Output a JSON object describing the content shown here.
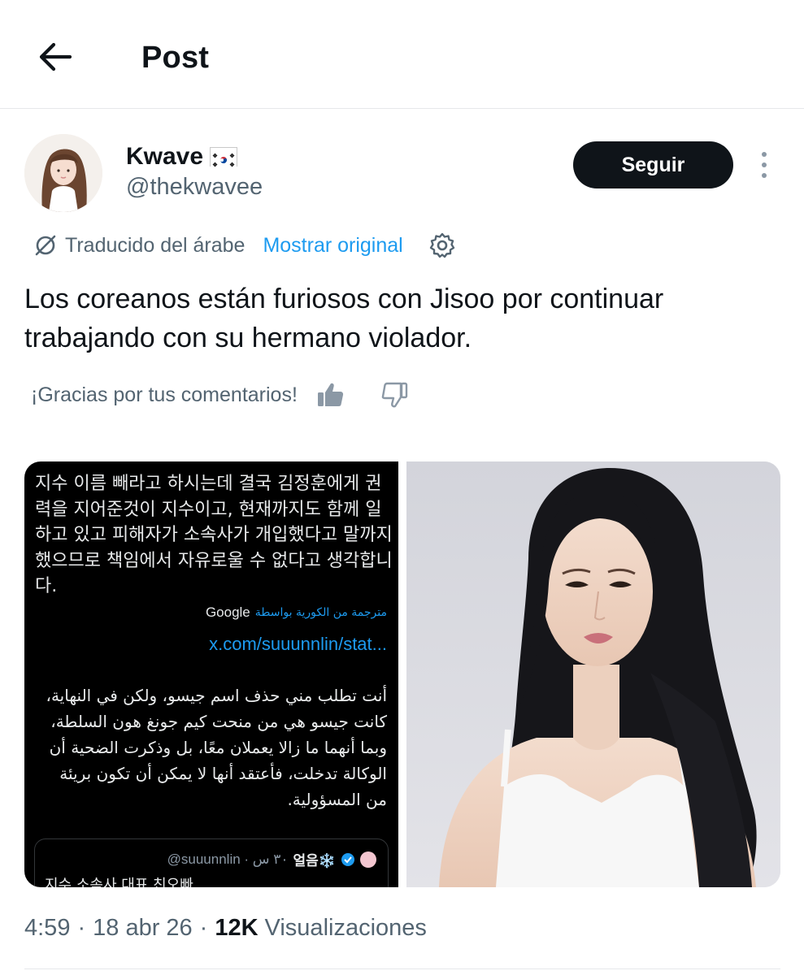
{
  "header": {
    "title": "Post",
    "back_icon": "arrow-left-icon"
  },
  "author": {
    "display_name": "Kwave",
    "flag": "flag-south-korea-icon",
    "handle": "@thekwavee",
    "follow_label": "Seguir"
  },
  "translation": {
    "note": "Traducido del árabe",
    "show_original": "Mostrar original",
    "icon": "translate-icon",
    "settings_icon": "gear-icon"
  },
  "tweet": {
    "text": "Los coreanos están furiosos con Jisoo por continuar trabajando con su hermano violador."
  },
  "feedback": {
    "prompt": "¡Gracias por tus comentarios!",
    "like_icon": "thumbs-up-icon",
    "dislike_icon": "thumbs-down-icon"
  },
  "media": {
    "screenshot": {
      "korean_text": "지수 이름 빼라고 하시는데 결국 김정훈에게 권력을 지어준것이 지수이고, 현재까지도 함께 일하고 있고 피해자가 소속사가 개입했다고 말까지 했으므로 책임에서 자유로울 수 없다고 생각합니다.",
      "translated_by_ar": "مترجمة من الكورية بواسطة",
      "translated_by_brand": "Google",
      "link_text": "x.com/suuunnlin/stat...",
      "arabic_text": "أنت تطلب مني حذف اسم جيسو، ولكن في النهاية، كانت جيسو هي من منحت كيم جونغ هون السلطة، وبما أنهما ما زالا يعملان معًا، بل وذكرت الضحية أن الوكالة تدخلت، فأعتقد أنها لا يمكن أن تكون بريئة من المسؤولية.",
      "quote_name": "얼음❄️",
      "quote_handle": "@suuunnlin · ٣٠ س",
      "quote_text": "지수 소속사 대표 친오빠"
    },
    "photo": {
      "subject": "portrait"
    }
  },
  "meta": {
    "time": "4:59",
    "date": "18 abr 26",
    "views_count": "12K",
    "views_label": "Visualizaciones"
  }
}
